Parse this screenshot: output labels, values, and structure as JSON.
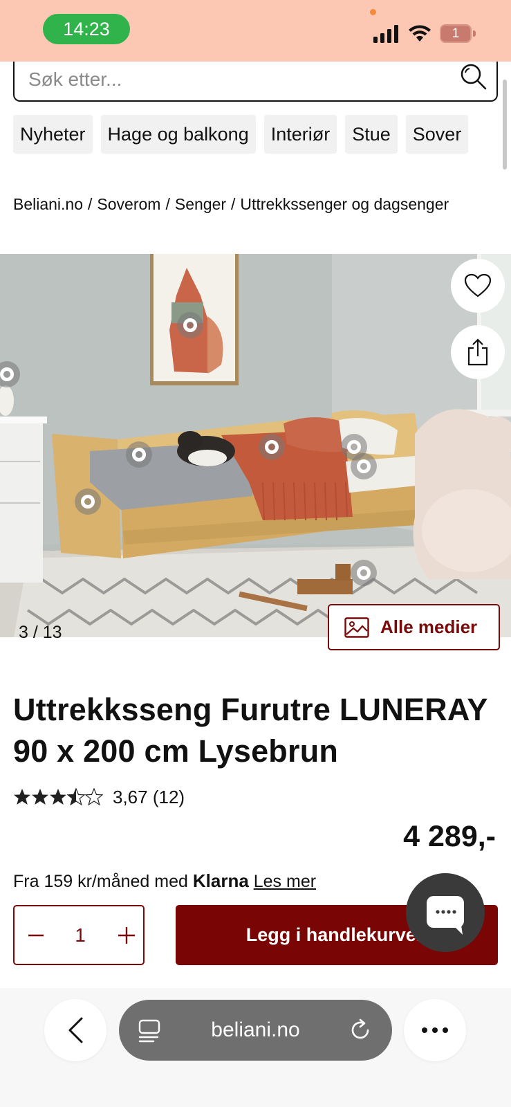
{
  "status_bar": {
    "time": "14:23",
    "battery": "1",
    "colors": {
      "background": "#fcc8b4",
      "time_pill": "#2fb34a"
    }
  },
  "search": {
    "placeholder": "Søk etter..."
  },
  "nav": {
    "items": [
      "Nyheter",
      "Hage og balkong",
      "Interiør",
      "Stue",
      "Sover"
    ]
  },
  "breadcrumb": {
    "items": [
      "Beliani.no",
      "Soverom",
      "Senger",
      "Uttrekkssenger og dagsenger"
    ],
    "separator": "/"
  },
  "gallery": {
    "current": "3",
    "total": "13",
    "counter_sep": "/",
    "all_media_label": "Alle medier",
    "icons": [
      "heart-icon",
      "share-icon",
      "image-icon"
    ]
  },
  "product": {
    "title": "Uttrekksseng Furutre LUNERAY 90 x 200 cm Lysebrun",
    "rating_value": 3.67,
    "rating_text": "3,67 (12)",
    "price": "4 289,-",
    "klarna": {
      "prefix": "Fra 159 kr/måned med",
      "brand": "Klarna",
      "link": "Les mer"
    }
  },
  "cart": {
    "quantity": "1",
    "add_label": "Legg i handlekurven"
  },
  "browser": {
    "url": "beliani.no"
  },
  "colors": {
    "brand": "#7a0505",
    "text": "#111111"
  }
}
